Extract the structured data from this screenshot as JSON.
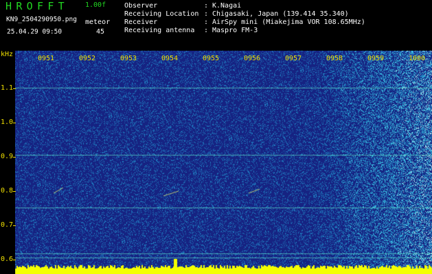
{
  "header": {
    "app_name": "HROFFT",
    "version": "1.00f",
    "filename": "KN9_2504290950.png",
    "mode": "meteor",
    "datetime": "25.04.29 09:50",
    "count": "45",
    "info": [
      {
        "label": "Observer",
        "value": "K.Nagai"
      },
      {
        "label": "Receiving Location",
        "value": "Chigasaki, Japan (139.414 35.340)"
      },
      {
        "label": "Receiver",
        "value": "AirSpy mini (Miakejima VOR 108.65MHz)"
      },
      {
        "label": "Receiving antenna",
        "value": "Maspro FM-3"
      }
    ]
  },
  "spectrogram": {
    "y_unit": "kHz",
    "y_ticks": [
      "1.1",
      "1.0",
      "0.9",
      "0.8",
      "0.7",
      "0.6"
    ],
    "x_ticks": [
      "0951",
      "0952",
      "0953",
      "0954",
      "0955",
      "0956",
      "0957",
      "0958",
      "0959",
      "1000"
    ],
    "colors": {
      "background": "#1f2a9a",
      "noise_hi": "#3ec8e0",
      "baseline": "#f4ff00",
      "text": "#f0e000",
      "title_green": "#22d822"
    }
  }
}
